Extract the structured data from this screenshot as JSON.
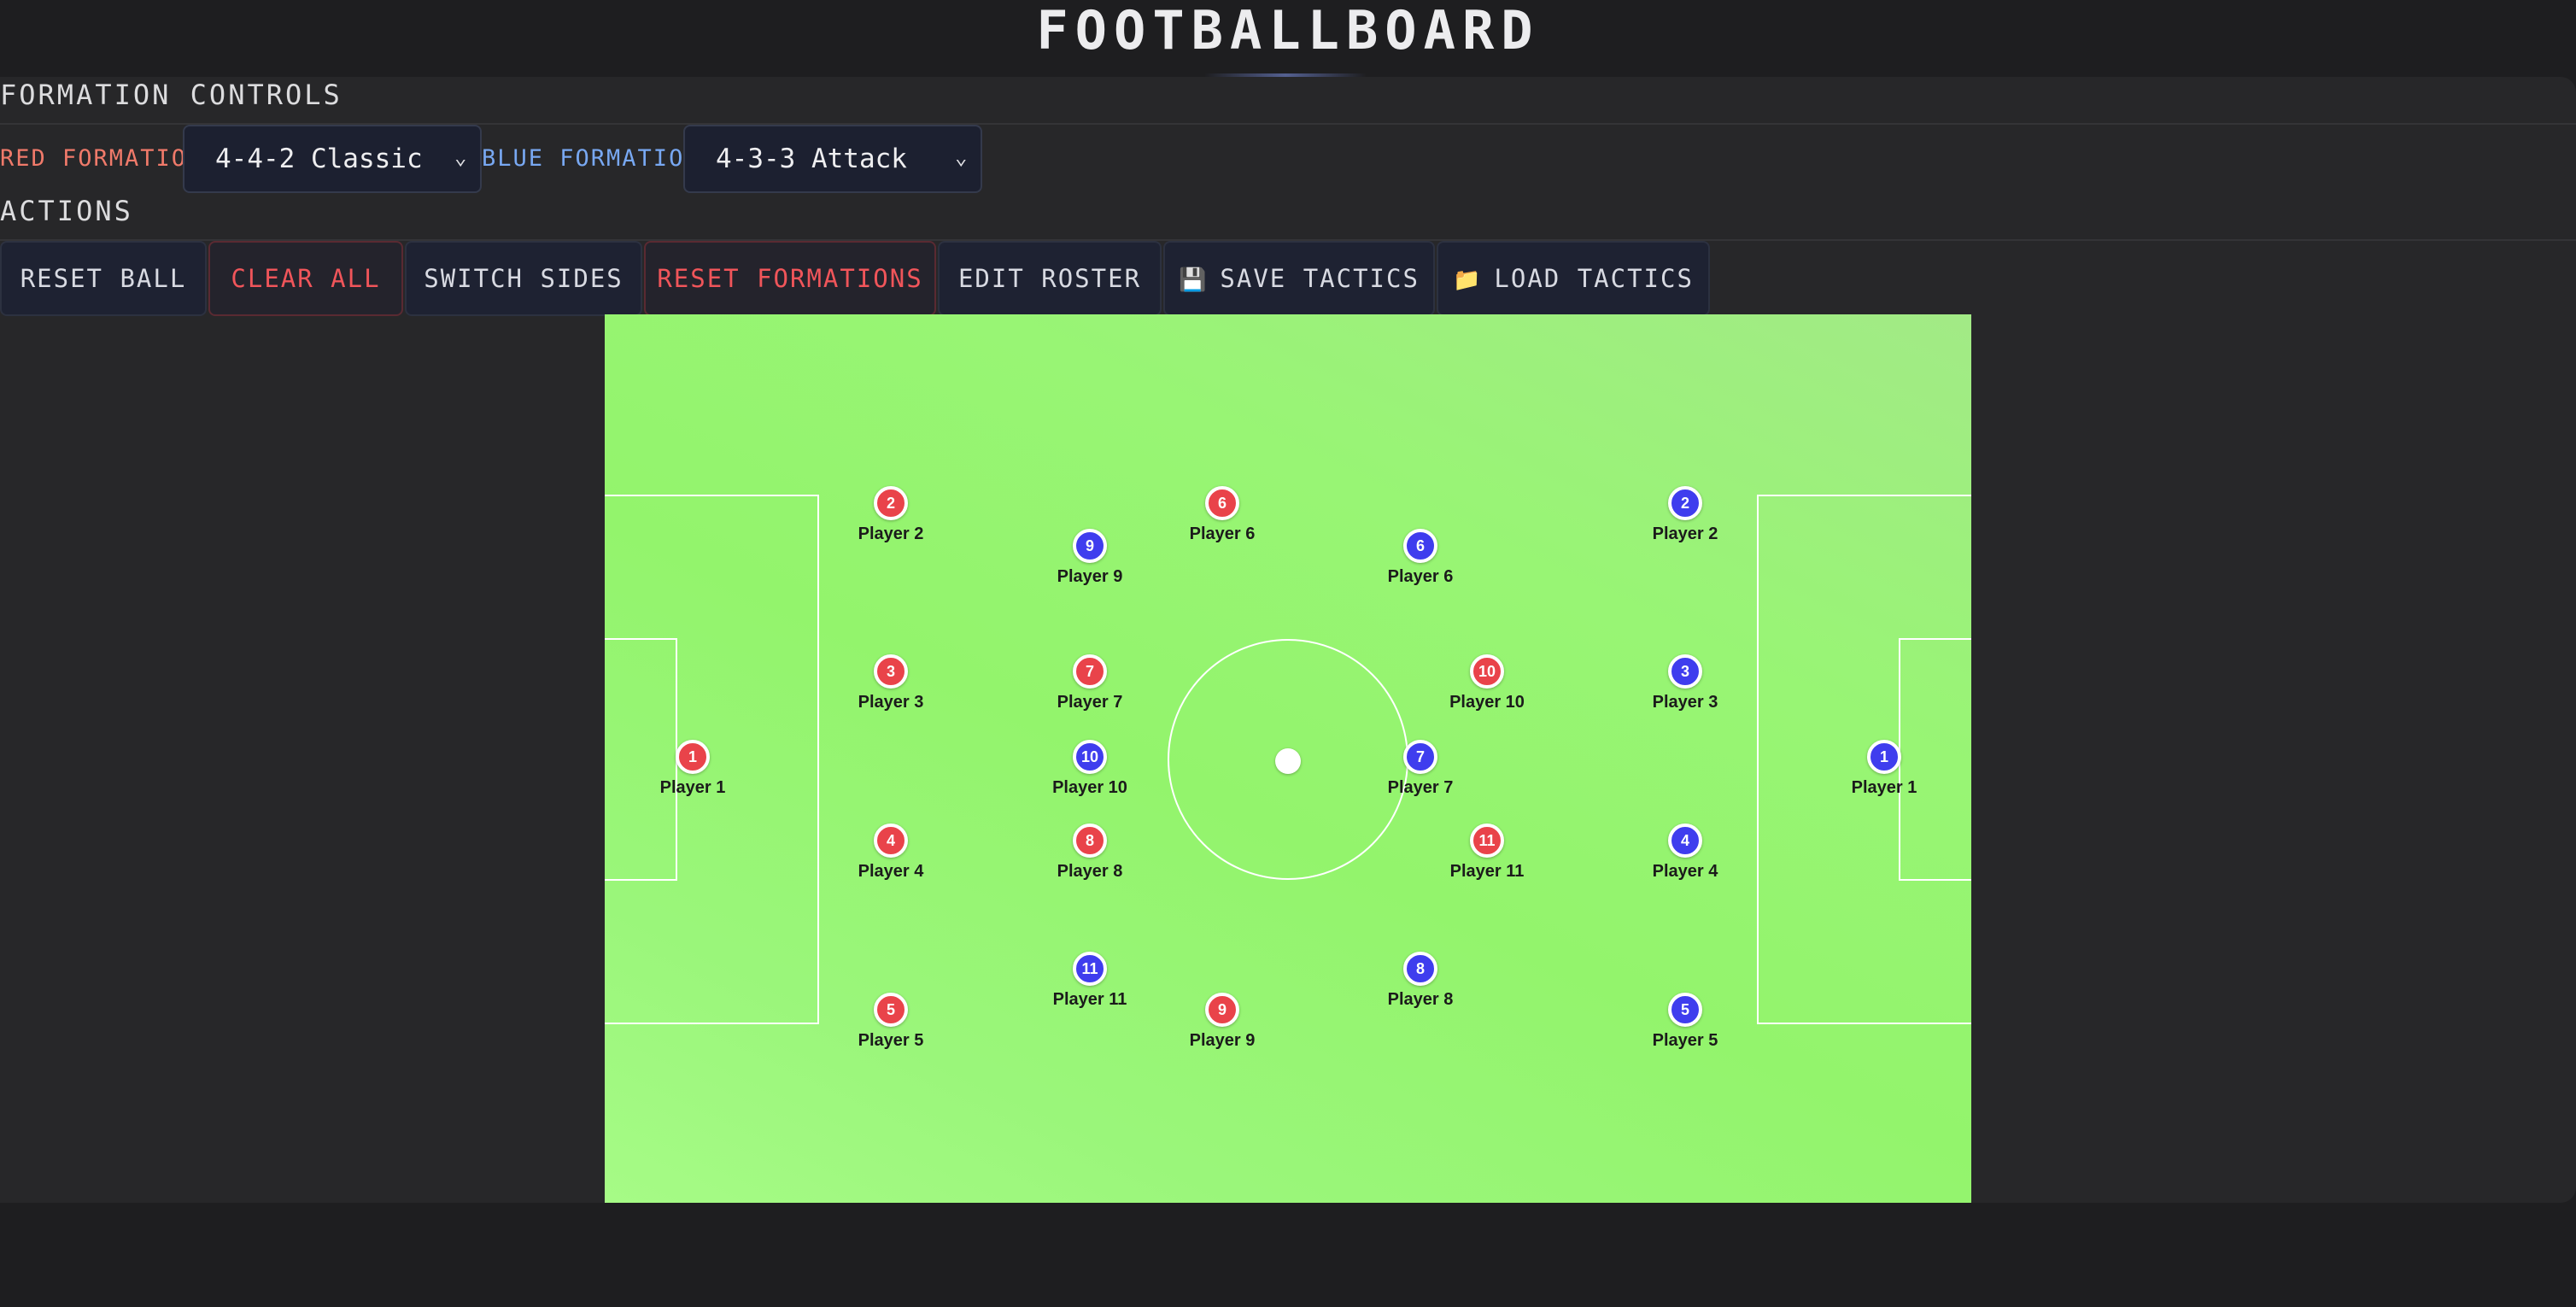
{
  "app": {
    "title": "FOOTBALLBOARD"
  },
  "formation_controls": {
    "heading": "FORMATION CONTROLS",
    "red_label": "RED FORMATION:",
    "red_value": "4-4-2 Classic",
    "blue_label": "BLUE FORMATION:",
    "blue_value": "4-3-3 Attack"
  },
  "actions": {
    "heading": "ACTIONS",
    "reset_ball": "RESET BALL",
    "clear_all": "CLEAR ALL",
    "switch_sides": "SWITCH SIDES",
    "reset_formations": "RESET FORMATIONS",
    "edit_roster": "EDIT ROSTER",
    "save_tactics": "SAVE TACTICS",
    "save_icon": "floppy-disk-icon",
    "load_tactics": "LOAD TACTICS",
    "load_icon": "folder-icon"
  },
  "colors": {
    "red_team": "#e9434a",
    "blue_team": "#3f3dee",
    "pitch": "#96f470",
    "danger": "#f0555a"
  },
  "red_team": [
    {
      "number": "1",
      "label": "Player 1"
    },
    {
      "number": "2",
      "label": "Player 2"
    },
    {
      "number": "3",
      "label": "Player 3"
    },
    {
      "number": "4",
      "label": "Player 4"
    },
    {
      "number": "5",
      "label": "Player 5"
    },
    {
      "number": "6",
      "label": "Player 6"
    },
    {
      "number": "7",
      "label": "Player 7"
    },
    {
      "number": "8",
      "label": "Player 8"
    },
    {
      "number": "9",
      "label": "Player 9"
    },
    {
      "number": "10",
      "label": "Player 10"
    },
    {
      "number": "11",
      "label": "Player 11"
    }
  ],
  "blue_team": [
    {
      "number": "1",
      "label": "Player 1"
    },
    {
      "number": "2",
      "label": "Player 2"
    },
    {
      "number": "3",
      "label": "Player 3"
    },
    {
      "number": "4",
      "label": "Player 4"
    },
    {
      "number": "5",
      "label": "Player 5"
    },
    {
      "number": "6",
      "label": "Player 6"
    },
    {
      "number": "7",
      "label": "Player 7"
    },
    {
      "number": "8",
      "label": "Player 8"
    },
    {
      "number": "9",
      "label": "Player 9"
    },
    {
      "number": "10",
      "label": "Player 10"
    },
    {
      "number": "11",
      "label": "Player 11"
    }
  ]
}
